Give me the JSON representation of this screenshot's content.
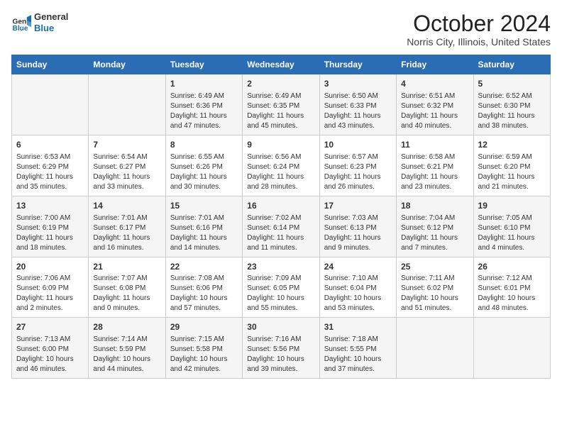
{
  "header": {
    "logo_line1": "General",
    "logo_line2": "Blue",
    "month": "October 2024",
    "location": "Norris City, Illinois, United States"
  },
  "weekdays": [
    "Sunday",
    "Monday",
    "Tuesday",
    "Wednesday",
    "Thursday",
    "Friday",
    "Saturday"
  ],
  "weeks": [
    [
      {
        "day": "",
        "info": ""
      },
      {
        "day": "",
        "info": ""
      },
      {
        "day": "1",
        "info": "Sunrise: 6:49 AM\nSunset: 6:36 PM\nDaylight: 11 hours and 47 minutes."
      },
      {
        "day": "2",
        "info": "Sunrise: 6:49 AM\nSunset: 6:35 PM\nDaylight: 11 hours and 45 minutes."
      },
      {
        "day": "3",
        "info": "Sunrise: 6:50 AM\nSunset: 6:33 PM\nDaylight: 11 hours and 43 minutes."
      },
      {
        "day": "4",
        "info": "Sunrise: 6:51 AM\nSunset: 6:32 PM\nDaylight: 11 hours and 40 minutes."
      },
      {
        "day": "5",
        "info": "Sunrise: 6:52 AM\nSunset: 6:30 PM\nDaylight: 11 hours and 38 minutes."
      }
    ],
    [
      {
        "day": "6",
        "info": "Sunrise: 6:53 AM\nSunset: 6:29 PM\nDaylight: 11 hours and 35 minutes."
      },
      {
        "day": "7",
        "info": "Sunrise: 6:54 AM\nSunset: 6:27 PM\nDaylight: 11 hours and 33 minutes."
      },
      {
        "day": "8",
        "info": "Sunrise: 6:55 AM\nSunset: 6:26 PM\nDaylight: 11 hours and 30 minutes."
      },
      {
        "day": "9",
        "info": "Sunrise: 6:56 AM\nSunset: 6:24 PM\nDaylight: 11 hours and 28 minutes."
      },
      {
        "day": "10",
        "info": "Sunrise: 6:57 AM\nSunset: 6:23 PM\nDaylight: 11 hours and 26 minutes."
      },
      {
        "day": "11",
        "info": "Sunrise: 6:58 AM\nSunset: 6:21 PM\nDaylight: 11 hours and 23 minutes."
      },
      {
        "day": "12",
        "info": "Sunrise: 6:59 AM\nSunset: 6:20 PM\nDaylight: 11 hours and 21 minutes."
      }
    ],
    [
      {
        "day": "13",
        "info": "Sunrise: 7:00 AM\nSunset: 6:19 PM\nDaylight: 11 hours and 18 minutes."
      },
      {
        "day": "14",
        "info": "Sunrise: 7:01 AM\nSunset: 6:17 PM\nDaylight: 11 hours and 16 minutes."
      },
      {
        "day": "15",
        "info": "Sunrise: 7:01 AM\nSunset: 6:16 PM\nDaylight: 11 hours and 14 minutes."
      },
      {
        "day": "16",
        "info": "Sunrise: 7:02 AM\nSunset: 6:14 PM\nDaylight: 11 hours and 11 minutes."
      },
      {
        "day": "17",
        "info": "Sunrise: 7:03 AM\nSunset: 6:13 PM\nDaylight: 11 hours and 9 minutes."
      },
      {
        "day": "18",
        "info": "Sunrise: 7:04 AM\nSunset: 6:12 PM\nDaylight: 11 hours and 7 minutes."
      },
      {
        "day": "19",
        "info": "Sunrise: 7:05 AM\nSunset: 6:10 PM\nDaylight: 11 hours and 4 minutes."
      }
    ],
    [
      {
        "day": "20",
        "info": "Sunrise: 7:06 AM\nSunset: 6:09 PM\nDaylight: 11 hours and 2 minutes."
      },
      {
        "day": "21",
        "info": "Sunrise: 7:07 AM\nSunset: 6:08 PM\nDaylight: 11 hours and 0 minutes."
      },
      {
        "day": "22",
        "info": "Sunrise: 7:08 AM\nSunset: 6:06 PM\nDaylight: 10 hours and 57 minutes."
      },
      {
        "day": "23",
        "info": "Sunrise: 7:09 AM\nSunset: 6:05 PM\nDaylight: 10 hours and 55 minutes."
      },
      {
        "day": "24",
        "info": "Sunrise: 7:10 AM\nSunset: 6:04 PM\nDaylight: 10 hours and 53 minutes."
      },
      {
        "day": "25",
        "info": "Sunrise: 7:11 AM\nSunset: 6:02 PM\nDaylight: 10 hours and 51 minutes."
      },
      {
        "day": "26",
        "info": "Sunrise: 7:12 AM\nSunset: 6:01 PM\nDaylight: 10 hours and 48 minutes."
      }
    ],
    [
      {
        "day": "27",
        "info": "Sunrise: 7:13 AM\nSunset: 6:00 PM\nDaylight: 10 hours and 46 minutes."
      },
      {
        "day": "28",
        "info": "Sunrise: 7:14 AM\nSunset: 5:59 PM\nDaylight: 10 hours and 44 minutes."
      },
      {
        "day": "29",
        "info": "Sunrise: 7:15 AM\nSunset: 5:58 PM\nDaylight: 10 hours and 42 minutes."
      },
      {
        "day": "30",
        "info": "Sunrise: 7:16 AM\nSunset: 5:56 PM\nDaylight: 10 hours and 39 minutes."
      },
      {
        "day": "31",
        "info": "Sunrise: 7:18 AM\nSunset: 5:55 PM\nDaylight: 10 hours and 37 minutes."
      },
      {
        "day": "",
        "info": ""
      },
      {
        "day": "",
        "info": ""
      }
    ]
  ]
}
